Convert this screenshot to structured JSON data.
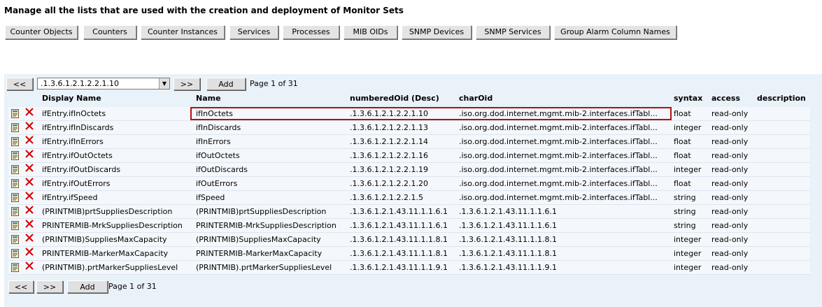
{
  "page": {
    "title": "Manage all the lists that are used with the creation and deployment of Monitor Sets"
  },
  "tabs": [
    "Counter Objects",
    "Counters",
    "Counter Instances",
    "Services",
    "Processes",
    "MIB OIDs",
    "SNMP Devices",
    "SNMP Services",
    "Group Alarm Column Names"
  ],
  "pager_top": {
    "prev_label": "<<",
    "selected_oid": ".1.3.6.1.2.1.2.2.1.10",
    "next_label": ">>",
    "add_label": "Add",
    "page_text": "Page 1 of 31"
  },
  "columns": {
    "display_name": "Display Name",
    "name": "Name",
    "numbered_oid": "numberedOid (Desc)",
    "char_oid": "charOid",
    "syntax": "syntax",
    "access": "access",
    "description": "description"
  },
  "rows": [
    {
      "display": "ifEntry.ifInOctets",
      "name": "ifInOctets",
      "oid": ".1.3.6.1.2.1.2.2.1.10",
      "char": ".iso.org.dod.internet.mgmt.mib-2.interfaces.ifTabl...",
      "syntax": "float",
      "access": "read-only",
      "description": ""
    },
    {
      "display": "ifEntry.ifInDiscards",
      "name": "ifInDiscards",
      "oid": ".1.3.6.1.2.1.2.2.1.13",
      "char": ".iso.org.dod.internet.mgmt.mib-2.interfaces.ifTabl...",
      "syntax": "integer",
      "access": "read-only",
      "description": ""
    },
    {
      "display": "ifEntry.ifInErrors",
      "name": "ifInErrors",
      "oid": ".1.3.6.1.2.1.2.2.1.14",
      "char": ".iso.org.dod.internet.mgmt.mib-2.interfaces.ifTabl...",
      "syntax": "float",
      "access": "read-only",
      "description": ""
    },
    {
      "display": "ifEntry.ifOutOctets",
      "name": "ifOutOctets",
      "oid": ".1.3.6.1.2.1.2.2.1.16",
      "char": ".iso.org.dod.internet.mgmt.mib-2.interfaces.ifTabl...",
      "syntax": "float",
      "access": "read-only",
      "description": ""
    },
    {
      "display": "ifEntry.ifOutDiscards",
      "name": "ifOutDiscards",
      "oid": ".1.3.6.1.2.1.2.2.1.19",
      "char": ".iso.org.dod.internet.mgmt.mib-2.interfaces.ifTabl...",
      "syntax": "integer",
      "access": "read-only",
      "description": ""
    },
    {
      "display": "ifEntry.ifOutErrors",
      "name": "ifOutErrors",
      "oid": ".1.3.6.1.2.1.2.2.1.20",
      "char": ".iso.org.dod.internet.mgmt.mib-2.interfaces.ifTabl...",
      "syntax": "float",
      "access": "read-only",
      "description": ""
    },
    {
      "display": "ifEntry.ifSpeed",
      "name": "ifSpeed",
      "oid": ".1.3.6.1.2.1.2.2.1.5",
      "char": ".iso.org.dod.internet.mgmt.mib-2.interfaces.ifTabl...",
      "syntax": "string",
      "access": "read-only",
      "description": ""
    },
    {
      "display": "(PRINTMIB)prtSuppliesDescription",
      "name": "(PRINTMIB)prtSuppliesDescription",
      "oid": ".1.3.6.1.2.1.43.11.1.1.6.1",
      "char": ".1.3.6.1.2.1.43.11.1.1.6.1",
      "syntax": "string",
      "access": "read-only",
      "description": ""
    },
    {
      "display": "PRINTERMIB-MrkSuppliesDescription",
      "name": "PRINTERMIB-MrkSuppliesDescription",
      "oid": ".1.3.6.1.2.1.43.11.1.1.6.1",
      "char": ".1.3.6.1.2.1.43.11.1.1.6.1",
      "syntax": "string",
      "access": "read-only",
      "description": ""
    },
    {
      "display": "(PRINTMIB)SuppliesMaxCapacity",
      "name": "(PRINTMIB)SuppliesMaxCapacity",
      "oid": ".1.3.6.1.2.1.43.11.1.1.8.1",
      "char": ".1.3.6.1.2.1.43.11.1.1.8.1",
      "syntax": "integer",
      "access": "read-only",
      "description": ""
    },
    {
      "display": "PRINTERMIB-MarkerMaxCapacity",
      "name": "PRINTERMIB-MarkerMaxCapacity",
      "oid": ".1.3.6.1.2.1.43.11.1.1.8.1",
      "char": ".1.3.6.1.2.1.43.11.1.1.8.1",
      "syntax": "integer",
      "access": "read-only",
      "description": ""
    },
    {
      "display": "(PRINTMIB).prtMarkerSuppliesLevel",
      "name": "(PRINTMIB).prtMarkerSuppliesLevel",
      "oid": ".1.3.6.1.2.1.43.11.1.1.9.1",
      "char": ".1.3.6.1.2.1.43.11.1.1.9.1",
      "syntax": "integer",
      "access": "read-only",
      "description": ""
    }
  ],
  "pager_bottom": {
    "prev_label": "<<",
    "next_label": ">>",
    "add_label": "Add",
    "page_text": "Page 1 of 31"
  },
  "icons": {
    "edit": "edit-document-icon",
    "delete": "delete-x-icon"
  },
  "colors": {
    "panel_bg": "#e9f1f9",
    "row_bg": "#f4f7fb",
    "highlight": "#b31010",
    "delete": "#d40000"
  }
}
